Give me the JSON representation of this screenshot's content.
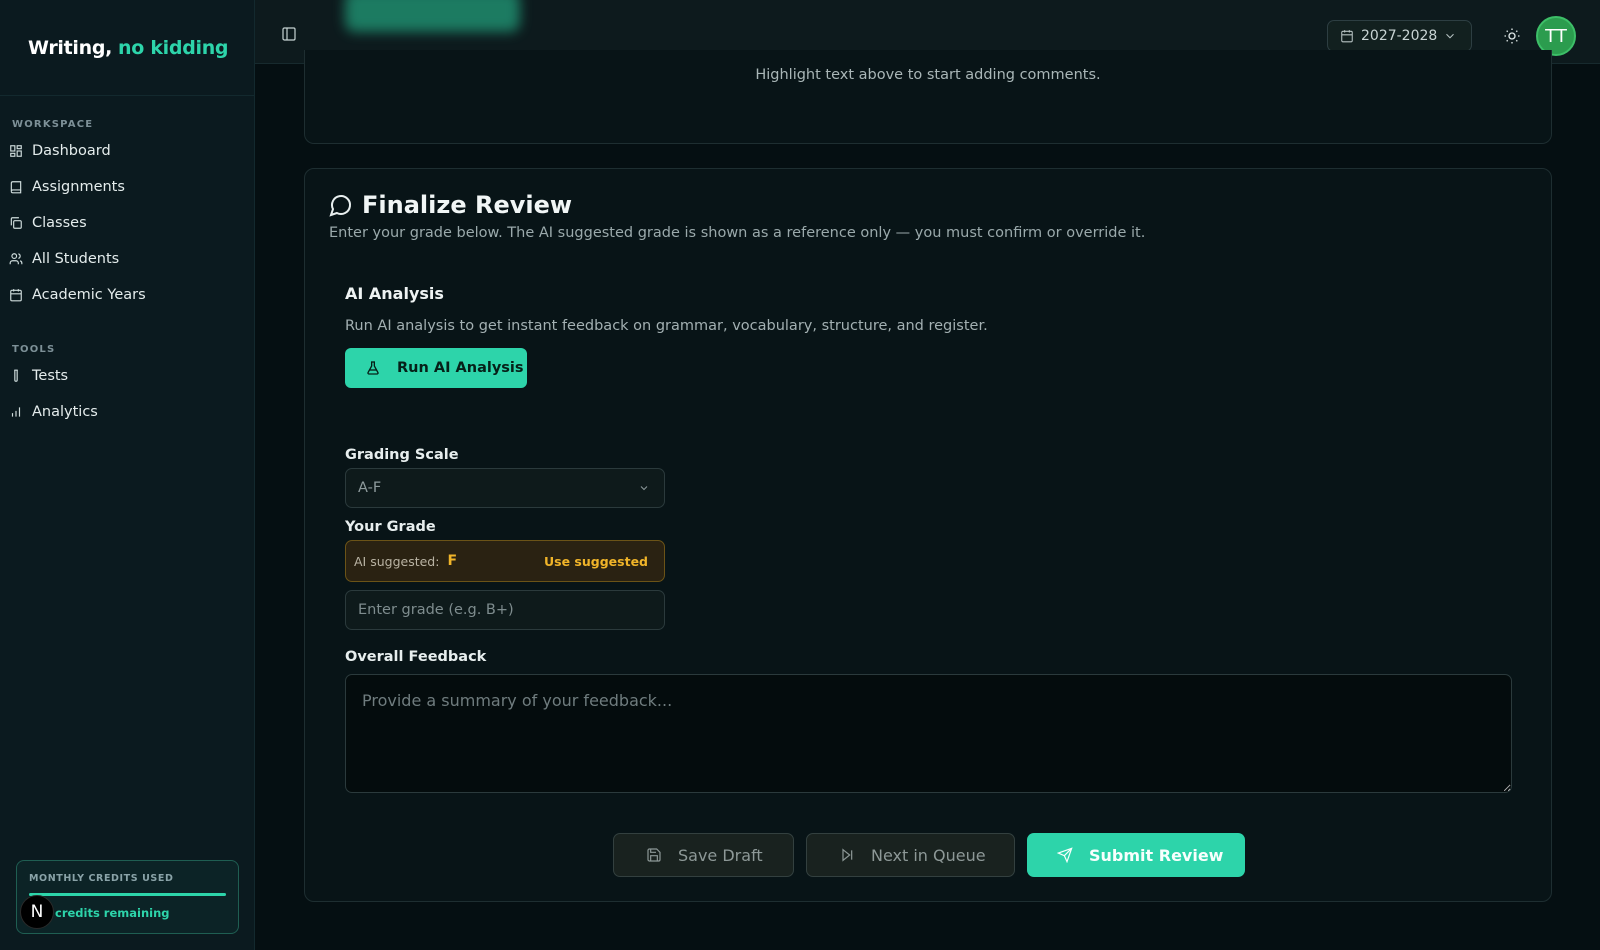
{
  "brand": {
    "part1": "Writing,",
    "part2": "no kidding"
  },
  "sidebar": {
    "workspace_heading": "WORKSPACE",
    "workspace_items": [
      {
        "label": "Dashboard",
        "icon": "dashboard-icon"
      },
      {
        "label": "Assignments",
        "icon": "book-icon"
      },
      {
        "label": "Classes",
        "icon": "copy-icon"
      },
      {
        "label": "All Students",
        "icon": "users-icon"
      },
      {
        "label": "Academic Years",
        "icon": "calendar-icon"
      }
    ],
    "tools_heading": "TOOLS",
    "tools_items": [
      {
        "label": "Tests",
        "icon": "test-tube-icon"
      },
      {
        "label": "Analytics",
        "icon": "bar-chart-icon"
      }
    ],
    "credits": {
      "label": "MONTHLY CREDITS USED",
      "remaining": "credits remaining",
      "used_fraction": 1.0
    },
    "n_badge": "N"
  },
  "topbar": {
    "year": "2027-2028",
    "avatar_initials": "TT"
  },
  "comments_hint": "Highlight text above to start adding comments.",
  "finalize": {
    "title": "Finalize Review",
    "description": "Enter your grade below. The AI suggested grade is shown as a reference only — you must confirm or override it.",
    "ai_title": "AI Analysis",
    "ai_description": "Run AI analysis to get instant feedback on grammar, vocabulary, structure, and register.",
    "run_button": "Run AI Analysis",
    "grading_scale_label": "Grading Scale",
    "grading_scale_value": "A-F",
    "grade_label": "Your Grade",
    "ai_suggested_label": "AI suggested:",
    "ai_suggested_value": "F",
    "use_suggested": "Use suggested",
    "grade_placeholder": "Enter grade (e.g. B+)",
    "feedback_label": "Overall Feedback",
    "feedback_placeholder": "Provide a summary of your feedback...",
    "save_draft": "Save Draft",
    "next_in_queue": "Next in Queue",
    "submit_review": "Submit Review"
  },
  "colors": {
    "accent": "#2dd4aa",
    "warning": "#f0b429",
    "background": "#050f12",
    "avatar": "#2b9c4e"
  }
}
